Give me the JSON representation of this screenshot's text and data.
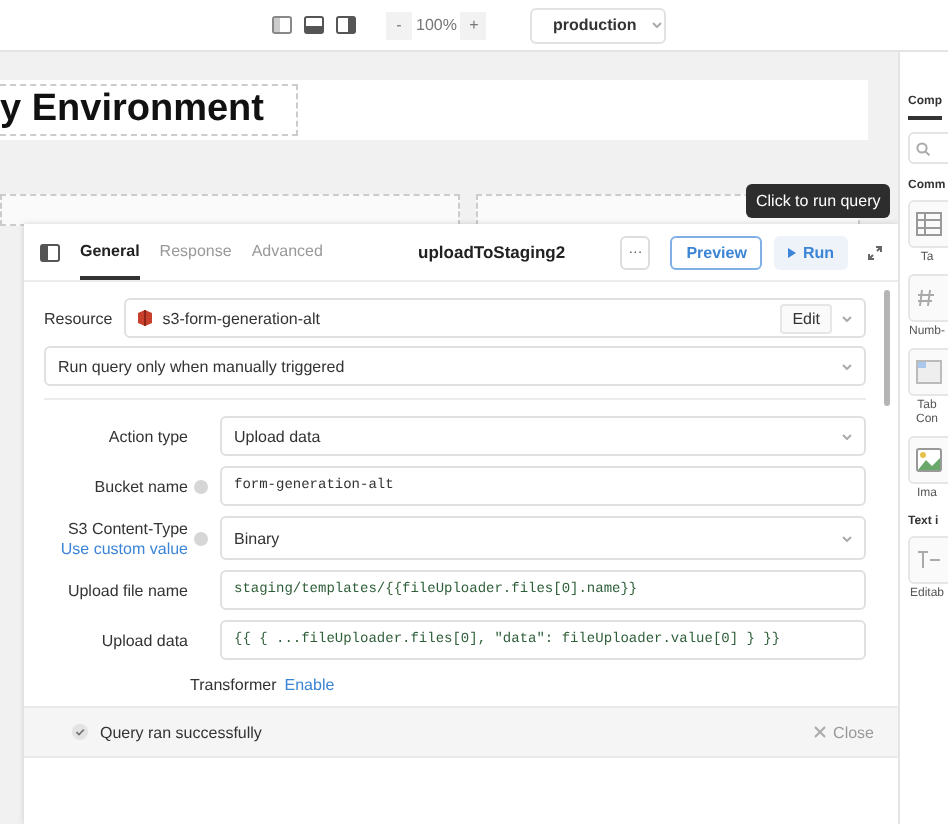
{
  "toolbar": {
    "zoom_out": "-",
    "zoom": "100%",
    "zoom_in": "+",
    "environment": "production"
  },
  "canvas": {
    "title": "y Environment",
    "tooltip": "Click to run query"
  },
  "query_panel": {
    "tabs": [
      {
        "label": "General",
        "selected": true
      },
      {
        "label": "Response",
        "selected": false
      },
      {
        "label": "Advanced",
        "selected": false
      }
    ],
    "name": "uploadToStaging2",
    "more": "···",
    "preview": "Preview",
    "run": "Run",
    "resource_label": "Resource",
    "resource": "s3-form-generation-alt",
    "edit": "Edit",
    "trigger": "Run query only when manually triggered",
    "fields": [
      {
        "kind": "select",
        "label": "Action type",
        "info": false,
        "value": "Upload data"
      },
      {
        "kind": "text",
        "label": "Bucket name",
        "info": true,
        "value": "form-generation-alt"
      },
      {
        "kind": "select",
        "label": "S3 Content-Type",
        "link": "Use custom value",
        "info": true,
        "value": "Binary"
      },
      {
        "kind": "code",
        "label": "Upload file name",
        "info": false,
        "value": "staging/templates/{{fileUploader.files[0].name}}"
      },
      {
        "kind": "code",
        "label": "Upload data",
        "info": false,
        "value": "{{ { ...fileUploader.files[0], \"data\": fileUploader.value[0] } }}"
      }
    ],
    "transformer": {
      "label": "Transformer",
      "link": "Enable"
    },
    "status": {
      "message": "Query ran successfully",
      "close": "Close"
    }
  },
  "right_panel": {
    "tab": "Comp",
    "section": "Comm",
    "tiles": [
      {
        "label": "Ta"
      },
      {
        "label": "Numb-"
      },
      {
        "label": "Tab Con"
      },
      {
        "label": "Ima"
      }
    ],
    "section2": "Text i",
    "tiles2": [
      {
        "label": "Editab"
      }
    ]
  }
}
